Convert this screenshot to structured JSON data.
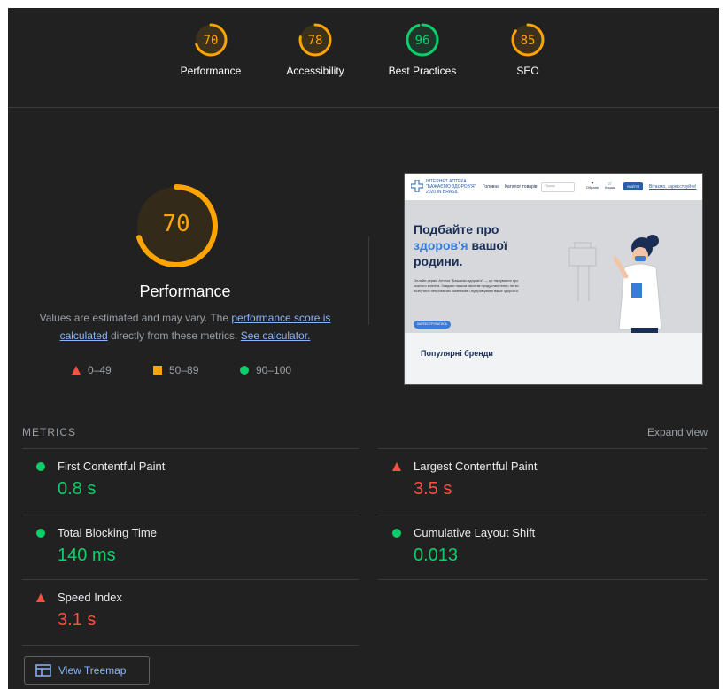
{
  "colors": {
    "pass": "#0cce6b",
    "average": "#ffa400",
    "fail": "#ff4e42",
    "background": "#212121",
    "link": "#8ab4f8"
  },
  "top_gauges": [
    {
      "score": 70,
      "label": "Performance",
      "color": "#ffa400"
    },
    {
      "score": 78,
      "label": "Accessibility",
      "color": "#ffa400"
    },
    {
      "score": 96,
      "label": "Best Practices",
      "color": "#0cce6b"
    },
    {
      "score": 85,
      "label": "SEO",
      "color": "#ffa400"
    }
  ],
  "performance": {
    "score": 70,
    "title": "Performance",
    "desc_before": "Values are estimated and may vary. The ",
    "desc_link": "performance score is calculated",
    "desc_middle": " directly from these metrics. ",
    "desc_calc_link": "See calculator.",
    "legend": [
      {
        "icon": "triangle-red-icon",
        "range": "0–49"
      },
      {
        "icon": "square-orange-icon",
        "range": "50–89"
      },
      {
        "icon": "circle-green-icon",
        "range": "90–100"
      }
    ]
  },
  "screenshot": {
    "logo_text": "ІНТЕРНЕТ АПТЕКА \"БАЖАЄМО ЗДОРОВ'Я\" 2020 IN BRASIL",
    "nav": [
      "Головна",
      "Каталог товарів"
    ],
    "search_placeholder": "Пошук",
    "icons": [
      "Обране",
      "Кошик"
    ],
    "login": "УВІЙТИ",
    "register": "Вітаємо, зареєструйте!",
    "hero_title_1": "Подбайте про",
    "hero_title_accent": "здоров'я",
    "hero_title_2": " вашої родини.",
    "hero_text": "Онлайн-сервіс Аптека \"Бажаємо здоров'я\" — це піклування про кожного клієнта. Завдяки нашим якісним продуктам тепер легко позбутися неприємних симптомів і підтримувати ваше здоров'я.",
    "hero_button": "ЗАРЕЄСТРУВАТИСЬ",
    "brands_title": "Популярні бренди"
  },
  "metrics": {
    "heading": "METRICS",
    "expand": "Expand view",
    "items": [
      {
        "name": "First Contentful Paint",
        "value": "0.8 s",
        "status": "pass"
      },
      {
        "name": "Largest Contentful Paint",
        "value": "3.5 s",
        "status": "fail"
      },
      {
        "name": "Total Blocking Time",
        "value": "140 ms",
        "status": "pass"
      },
      {
        "name": "Cumulative Layout Shift",
        "value": "0.013",
        "status": "pass"
      },
      {
        "name": "Speed Index",
        "value": "3.1 s",
        "status": "fail"
      }
    ]
  },
  "treemap_button": "View Treemap"
}
